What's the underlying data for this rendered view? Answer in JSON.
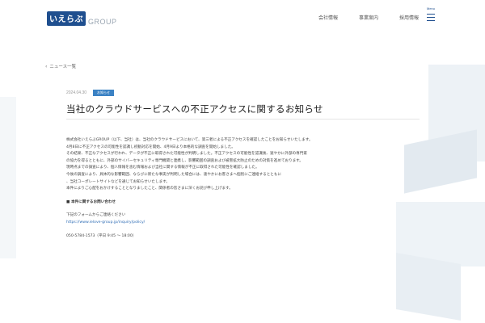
{
  "logo": {
    "mark": "いえらぶ",
    "group": "GROUP"
  },
  "nav": {
    "items": [
      "会社情報",
      "事業案内",
      "採用情報"
    ]
  },
  "menu": {
    "label": "Menu"
  },
  "back": {
    "label": "ニュース一覧"
  },
  "article": {
    "date": "2024.04.30",
    "badge": "お知らせ",
    "title": "当社のクラウドサービスへの不正アクセスに関するお知らせ",
    "paragraphs": [
      "株式会社いえらぶGROUP（以下、当社）は、当社のクラウドサービスにおいて、第三者による不正アクセスを確認したことをお知らせいたします。",
      "4月8日に不正アクセスの可能性を認識し初動対応を開始、4月9日より本格的な調査を開始しました。",
      "その結果、不正なアクセスが行われ、データが不正に取得された可能性が判明しました。不正アクセスの可能性を認識後、速やかに外部の専門家",
      "の協力を得るとともに、外部のサイバーセキュリティ専門機関と連携し、影響範囲の調査および被害拡大防止のための対策を進めております。",
      "現時点までの調査により、個人情報を含む情報および当社に関する情報が不正に取得された可能性を確認しました。",
      "今後の調査により、具体的な影響範囲、ならびに新たな事実が判明した場合には、速やかにお客さまへ個別にご連絡するとともに",
      "、当社コーポレートサイトなどを通じてお知らせいたします。",
      "本件によりご心配をおかけすることとなりましたこと、関係者の皆さまに深くお詫び申し上げます。"
    ],
    "contact_heading": "■ 本件に関するお問い合わせ",
    "contact_intro": "下記のフォームからご連絡ください",
    "contact_url": "https://www.ielove-group.jp/inquiry/policy/",
    "contact_phone": "050-5784-1573（平日 9:45 ～ 18:00）"
  }
}
